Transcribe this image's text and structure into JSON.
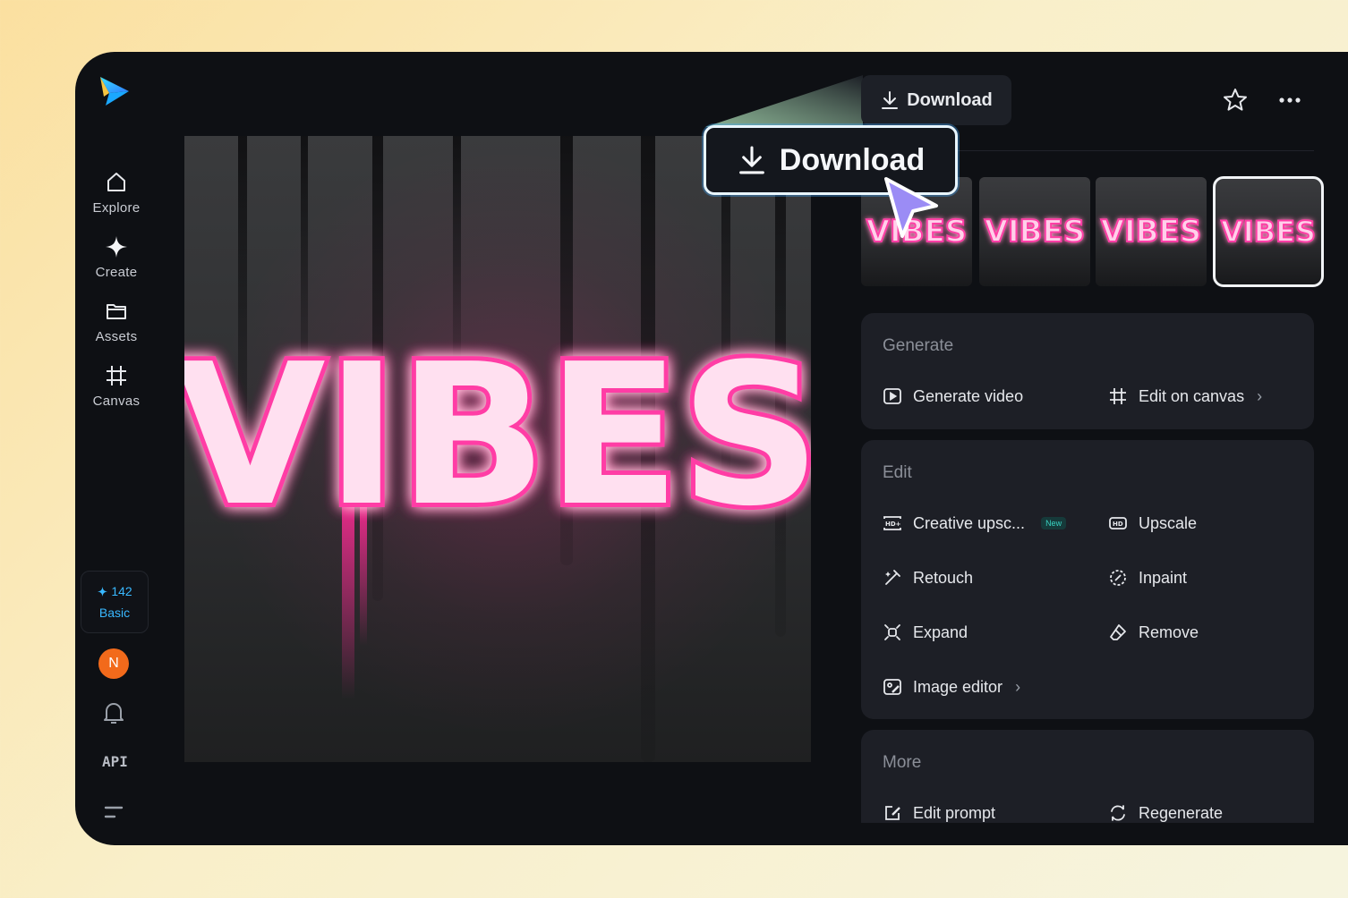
{
  "sidebar": {
    "logo_icon": "paper-plane-logo",
    "items": [
      {
        "label": "Explore",
        "icon": "home-icon"
      },
      {
        "label": "Create",
        "icon": "sparkle-icon"
      },
      {
        "label": "Assets",
        "icon": "folder-icon"
      },
      {
        "label": "Canvas",
        "icon": "frame-icon"
      }
    ],
    "credits": {
      "count": "142",
      "plan": "Basic"
    },
    "avatar_initial": "N",
    "api_label": "API"
  },
  "header": {
    "download_label": "Download",
    "callout_label": "Download"
  },
  "main_image": {
    "text": "VIBES"
  },
  "thumbnails": [
    {
      "text": "VIBES"
    },
    {
      "text": "VIBES"
    },
    {
      "text": "VIBES"
    },
    {
      "text": "VIBES",
      "selected": true
    }
  ],
  "panels": {
    "generate": {
      "title": "Generate",
      "actions": [
        {
          "label": "Generate video"
        },
        {
          "label": "Edit on canvas"
        }
      ]
    },
    "edit": {
      "title": "Edit",
      "actions": [
        {
          "label": "Creative upsc...",
          "badge": "New"
        },
        {
          "label": "Upscale"
        },
        {
          "label": "Retouch"
        },
        {
          "label": "Inpaint"
        },
        {
          "label": "Expand"
        },
        {
          "label": "Remove"
        },
        {
          "label": "Image editor"
        }
      ]
    },
    "more": {
      "title": "More",
      "actions": [
        {
          "label": "Edit prompt"
        },
        {
          "label": "Regenerate"
        }
      ]
    }
  },
  "colors": {
    "accent": "#39b8ff",
    "neon_pink": "#ff3ea5",
    "panel_bg": "#1d1f26",
    "app_bg": "#0e1014"
  }
}
